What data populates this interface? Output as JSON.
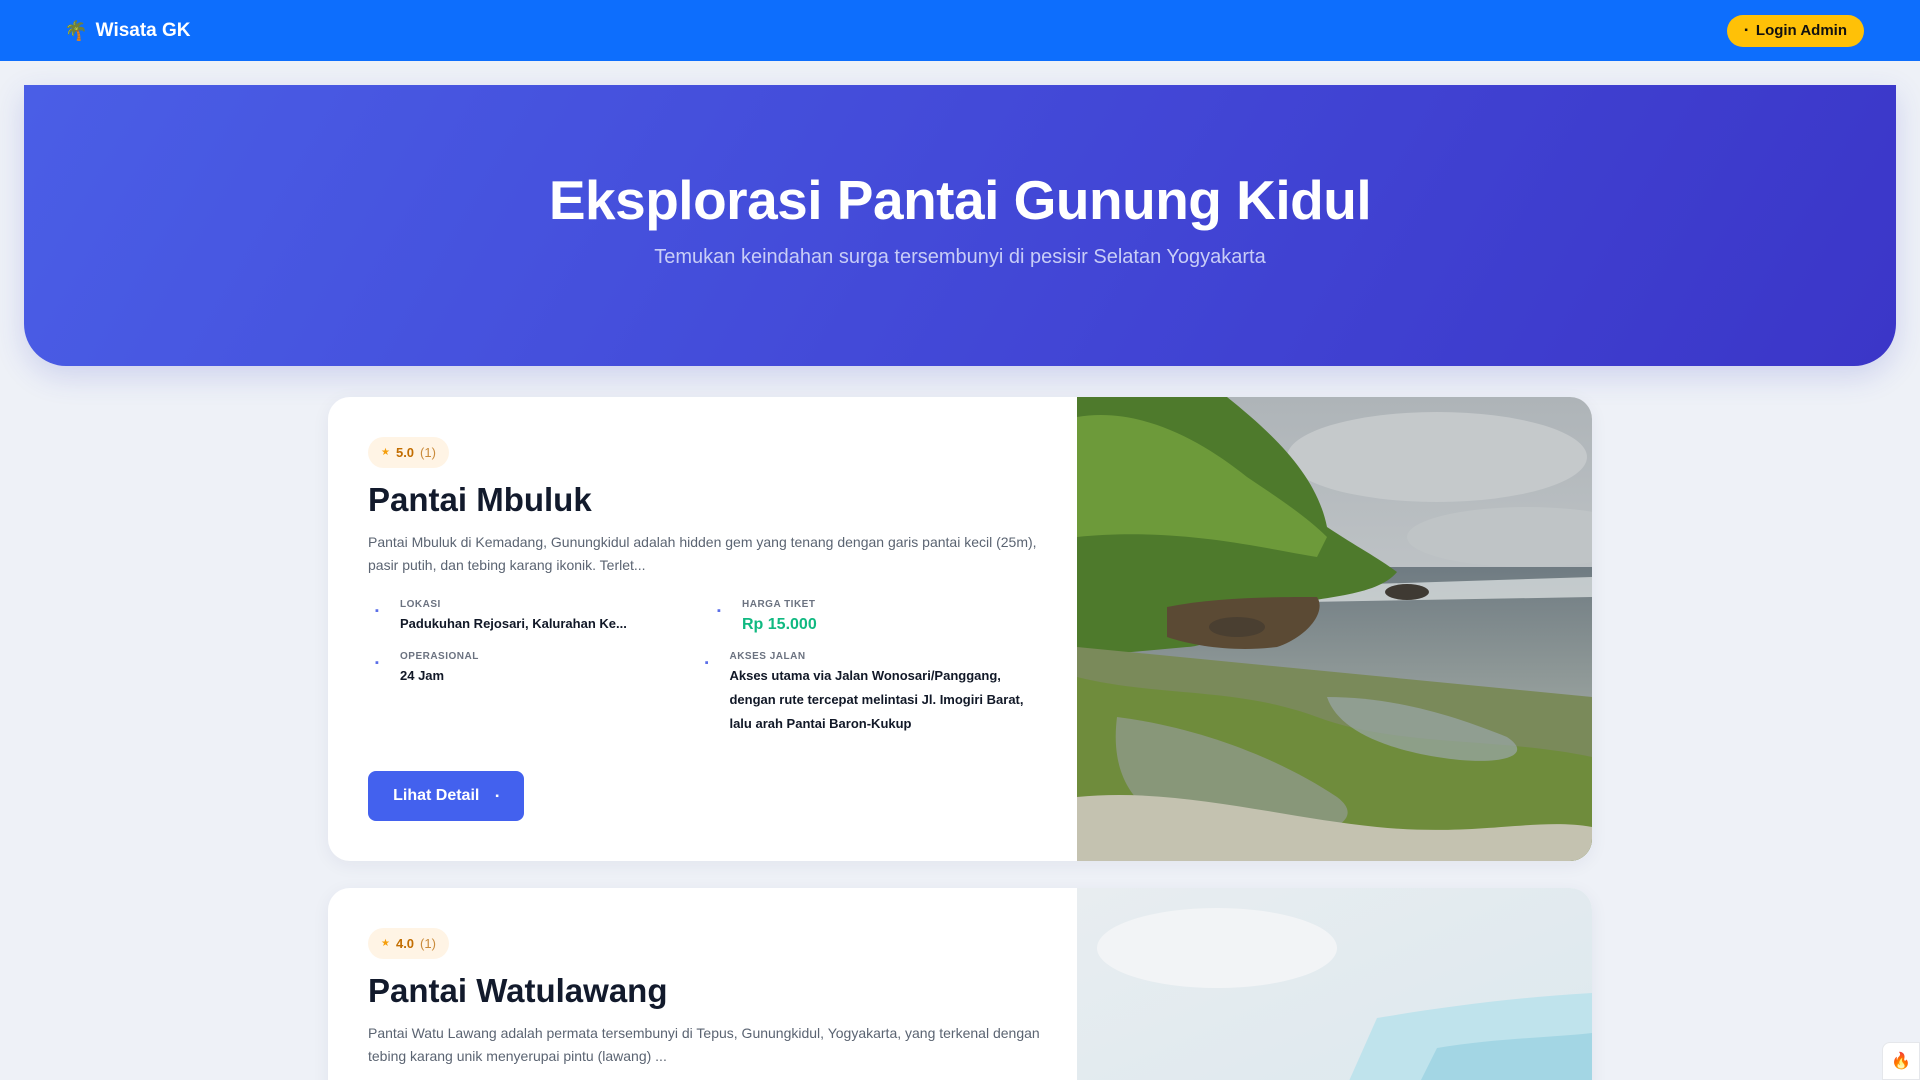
{
  "navbar": {
    "brand": "Wisata GK",
    "login_label": "Login Admin"
  },
  "hero": {
    "title": "Eksplorasi Pantai Gunung Kidul",
    "subtitle": "Temukan keindahan surga tersembunyi di pesisir Selatan Yogyakarta"
  },
  "beaches": [
    {
      "rating": "5.0",
      "rating_count": "(1)",
      "name": "Pantai Mbuluk",
      "description": "Pantai Mbuluk di Kemadang, Gunungkidul adalah hidden gem yang tenang dengan garis pantai kecil (25m), pasir putih, dan tebing karang ikonik. Terlet...",
      "location_label": "LOKASI",
      "location": "Padukuhan Rejosari, Kalurahan Ke...",
      "price_label": "HARGA TIKET",
      "price": "Rp 15.000",
      "hours_label": "OPERASIONAL",
      "hours": "24 Jam",
      "access_label": "AKSES JALAN",
      "access": "Akses utama via Jalan Wonosari/Panggang, dengan rute tercepat melintasi Jl. Imogiri Barat, lalu arah Pantai Baron-Kukup",
      "button_label": "Lihat Detail"
    },
    {
      "rating": "4.0",
      "rating_count": "(1)",
      "name": "Pantai Watulawang",
      "description": "Pantai Watu Lawang adalah permata tersembunyi di Tepus, Gunungkidul, Yogyakarta, yang terkenal dengan tebing karang unik menyerupai pintu (lawang) ..."
    }
  ],
  "colors": {
    "navbar": "#0d6efd",
    "accent": "#4361ee",
    "price": "#10b981",
    "login": "#ffc107"
  }
}
